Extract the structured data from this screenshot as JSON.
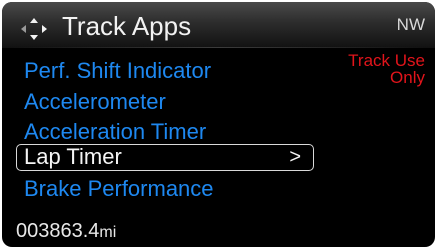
{
  "header": {
    "nav_icon": "four-way-arrow-icon",
    "title": "Track Apps",
    "compass_heading": "NW"
  },
  "notice": {
    "text": "Track Use Only",
    "color": "#e1141b"
  },
  "menu": {
    "items": [
      {
        "label": "Perf. Shift Indicator",
        "selected": false
      },
      {
        "label": "Accelerometer",
        "selected": false
      },
      {
        "label": "Acceleration Timer",
        "selected": false
      },
      {
        "label": "Lap Timer",
        "selected": true,
        "chevron": ">"
      },
      {
        "label": "Brake Performance",
        "selected": false
      }
    ],
    "item_color": "#1e88f0",
    "selected_color": "#f4f4f4"
  },
  "odometer": {
    "value": "003863.4",
    "unit": "mi"
  }
}
